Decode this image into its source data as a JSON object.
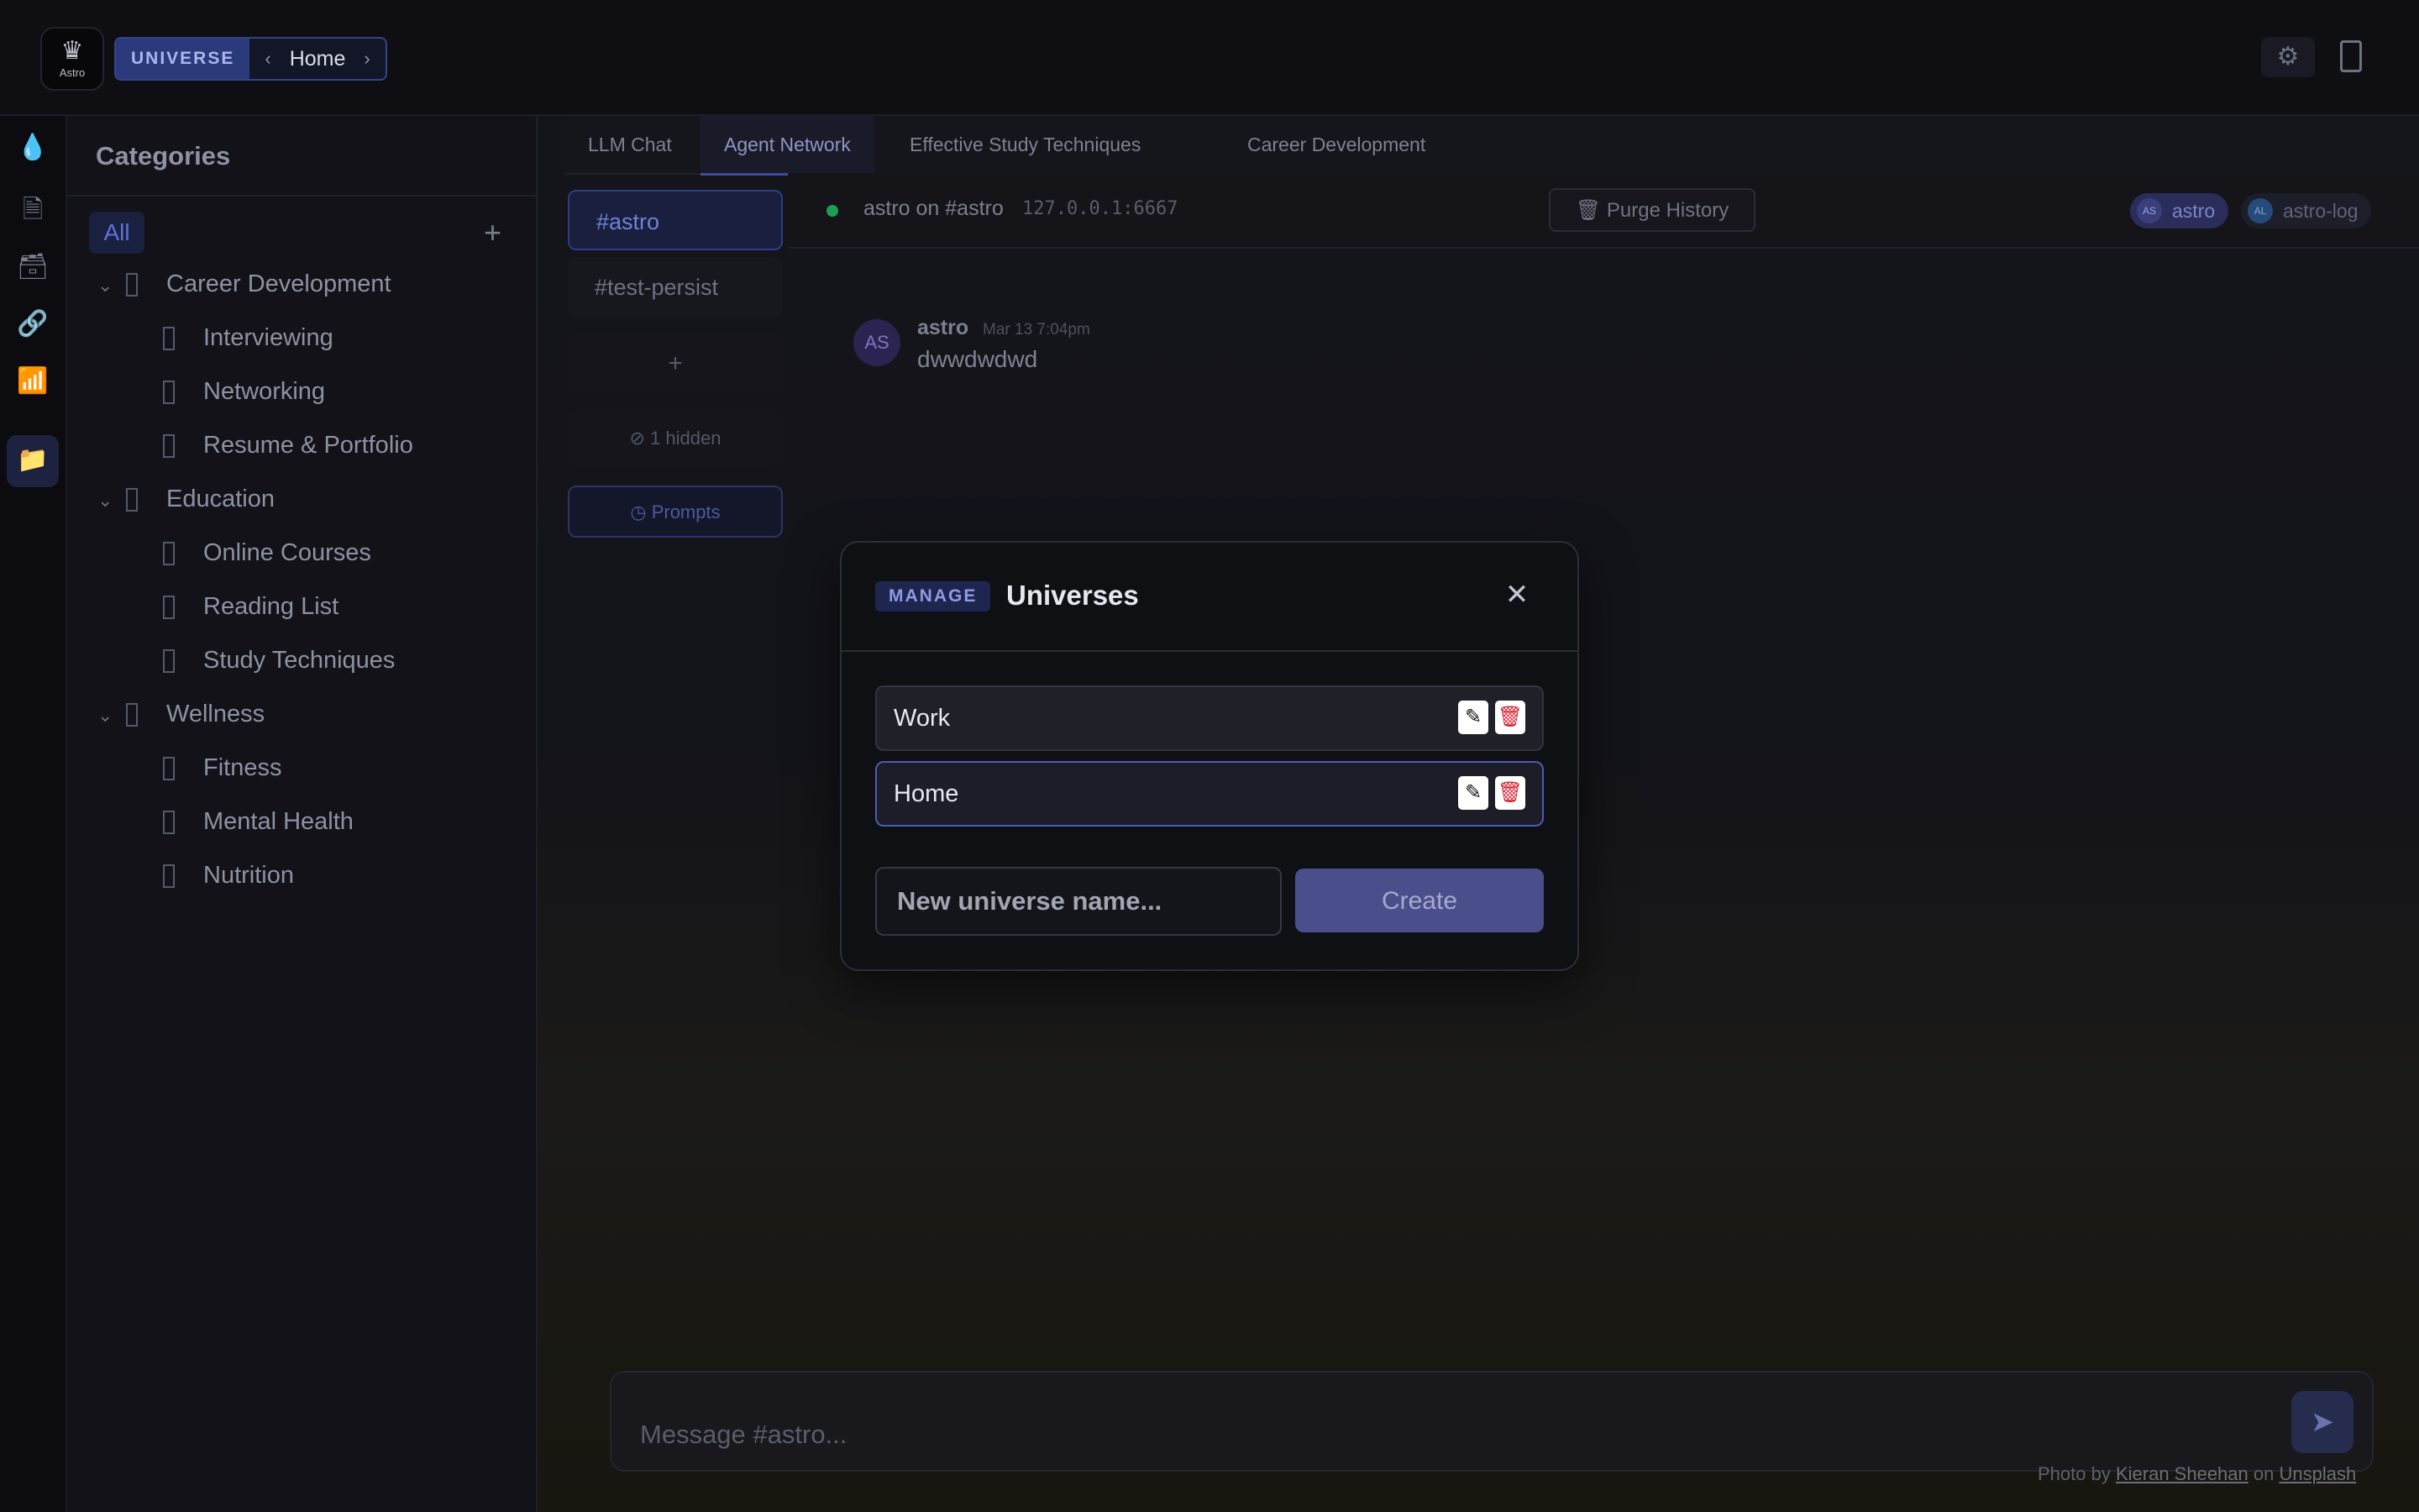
{
  "header": {
    "logo_text": "Astro",
    "breadcrumb_universe": "UNIVERSE",
    "breadcrumb_current": "Home"
  },
  "categories": {
    "title": "Categories",
    "all_label": "All",
    "tree": [
      {
        "label": "Career Development",
        "level": 0
      },
      {
        "label": "Interviewing",
        "level": 1
      },
      {
        "label": "Networking",
        "level": 1
      },
      {
        "label": "Resume & Portfolio",
        "level": 1
      },
      {
        "label": "Education",
        "level": 0
      },
      {
        "label": "Online Courses",
        "level": 1
      },
      {
        "label": "Reading List",
        "level": 1
      },
      {
        "label": "Study Techniques",
        "level": 1
      },
      {
        "label": "Wellness",
        "level": 0
      },
      {
        "label": "Fitness",
        "level": 1
      },
      {
        "label": "Mental Health",
        "level": 1
      },
      {
        "label": "Nutrition",
        "level": 1
      }
    ]
  },
  "tabs": [
    "LLM Chat",
    "Agent Network",
    "Effective Study Techniques",
    "Career Development"
  ],
  "channels": {
    "items": [
      "#astro",
      "#test-persist"
    ],
    "hidden_label": "1 hidden",
    "prompts_label": "Prompts"
  },
  "chat": {
    "title": "astro on #astro",
    "address": "127.0.0.1:6667",
    "purge_label": "Purge History",
    "chips": [
      {
        "initials": "AS",
        "name": "astro"
      },
      {
        "initials": "AL",
        "name": "astro-log"
      }
    ],
    "message": {
      "initials": "AS",
      "user": "astro",
      "time": "Mar 13 7:04pm",
      "text": "dwwdwdwd"
    },
    "composer_placeholder": "Message #astro...",
    "credit_prefix": "Photo by",
    "credit_author": "Kieran Sheehan",
    "credit_on": "on",
    "credit_site": "Unsplash"
  },
  "modal": {
    "badge": "MANAGE",
    "title": "Universes",
    "universes": [
      "Work",
      "Home"
    ],
    "active_universe": "Home",
    "new_placeholder": "New universe name...",
    "create_label": "Create"
  },
  "colors": {
    "accent": "#4c5bb8",
    "delete": "#d41f2a",
    "online": "#1f9d55"
  }
}
